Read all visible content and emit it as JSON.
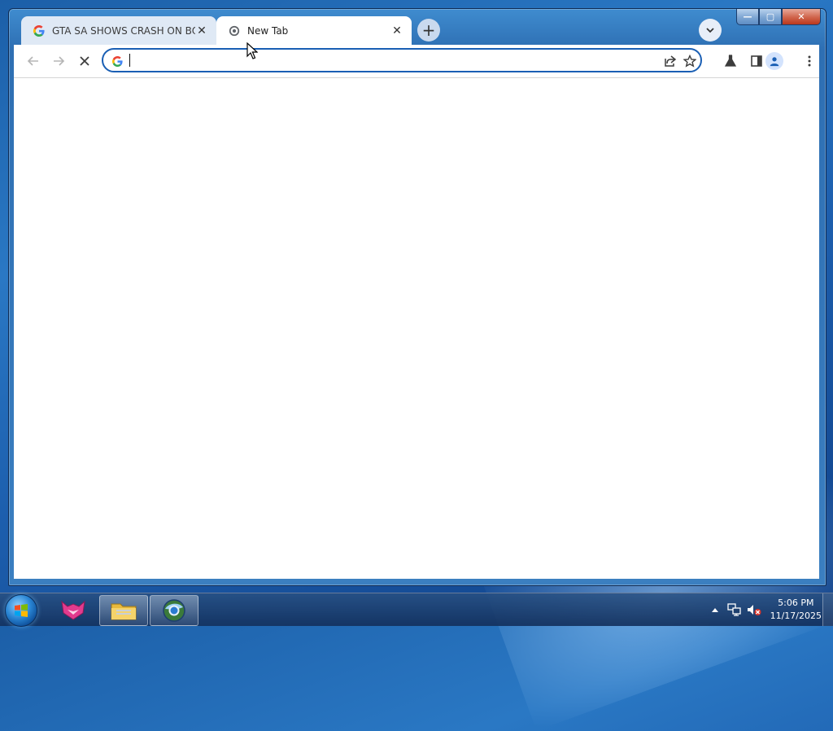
{
  "browser": {
    "tabs": [
      {
        "title": "GTA SA SHOWS CRASH ON BOO",
        "close_label": "✕",
        "favicon": "google-g-icon"
      },
      {
        "title": "New Tab",
        "close_label": "✕",
        "favicon": "loading-spinner-icon"
      }
    ],
    "new_tab_label": "+",
    "window_controls": {
      "minimize": "—",
      "maximize": "▢",
      "close": "✕"
    },
    "omnibox": {
      "value": "",
      "placeholder": ""
    },
    "toolbar_icons": [
      "back-arrow-icon",
      "forward-arrow-icon",
      "stop-loading-icon",
      "share-icon",
      "bookmark-star-icon",
      "labs-flask-icon",
      "side-panel-icon",
      "profile-icon",
      "menu-dots-icon"
    ]
  },
  "taskbar": {
    "pinned": [
      "start-orb-icon",
      "app-fox-icon",
      "file-explorer-icon",
      "browser-app-icon"
    ],
    "tray": {
      "time": "5:06 PM",
      "date": "11/17/2025",
      "tray_icons": [
        "show-hidden-icons-arrow",
        "network-icon",
        "volume-muted-icon"
      ]
    }
  },
  "colors": {
    "accent": "#1a5fb4",
    "tab_inactive": "#dfe9f5",
    "taskbar": "#1d3f6e"
  }
}
